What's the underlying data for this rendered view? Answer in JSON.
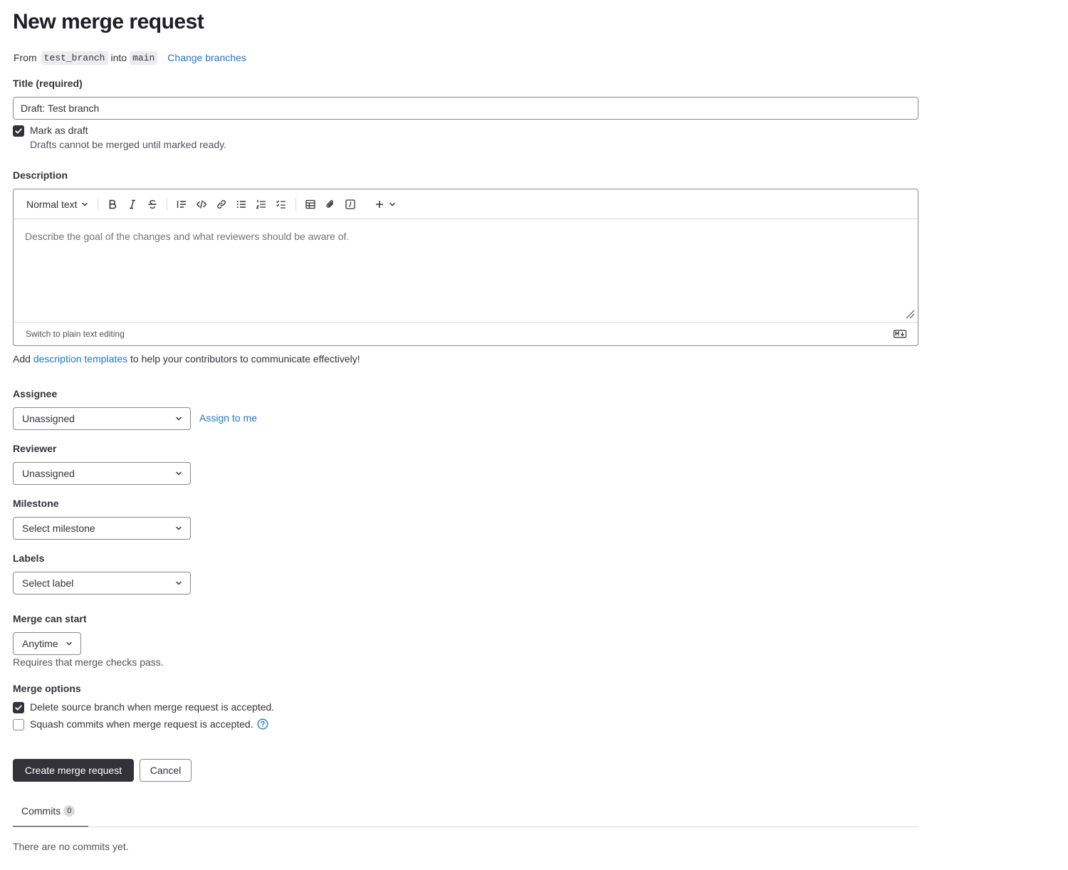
{
  "page_title": "New merge request",
  "branches": {
    "from_label": "From",
    "source": "test_branch",
    "into_label": "into",
    "target": "main",
    "change_link": "Change branches"
  },
  "title_field": {
    "label": "Title (required)",
    "value": "Draft: Test branch"
  },
  "draft": {
    "checked": true,
    "label": "Mark as draft",
    "help": "Drafts cannot be merged until marked ready."
  },
  "description": {
    "label": "Description",
    "toolbar": {
      "text_style": "Normal text",
      "buttons": [
        "bold-icon",
        "italic-icon",
        "strikethrough-icon",
        "blockquote-icon",
        "code-icon",
        "link-icon",
        "bullet-list-icon",
        "numbered-list-icon",
        "task-list-icon",
        "table-icon",
        "attachment-icon",
        "more-icon",
        "plus-icon"
      ]
    },
    "placeholder": "Describe the goal of the changes and what reviewers should be aware of.",
    "switch_mode": "Switch to plain text editing",
    "templates_prefix": "Add",
    "templates_link": "description templates",
    "templates_suffix": "to help your contributors to communicate effectively!"
  },
  "assignee": {
    "label": "Assignee",
    "value": "Unassigned",
    "assign_me": "Assign to me"
  },
  "reviewer": {
    "label": "Reviewer",
    "value": "Unassigned"
  },
  "milestone": {
    "label": "Milestone",
    "value": "Select milestone"
  },
  "labels": {
    "label": "Labels",
    "value": "Select label"
  },
  "merge_start": {
    "label": "Merge can start",
    "value": "Anytime",
    "help": "Requires that merge checks pass."
  },
  "merge_options": {
    "label": "Merge options",
    "delete_branch": {
      "checked": true,
      "label": "Delete source branch when merge request is accepted."
    },
    "squash": {
      "checked": false,
      "label": "Squash commits when merge request is accepted."
    }
  },
  "actions": {
    "create": "Create merge request",
    "cancel": "Cancel"
  },
  "tabs": {
    "commits_label": "Commits",
    "commits_count": "0",
    "empty_text": "There are no commits yet."
  },
  "colors": {
    "link": "#1f75cb",
    "primary_button": "#333238",
    "border": "#89888d"
  }
}
